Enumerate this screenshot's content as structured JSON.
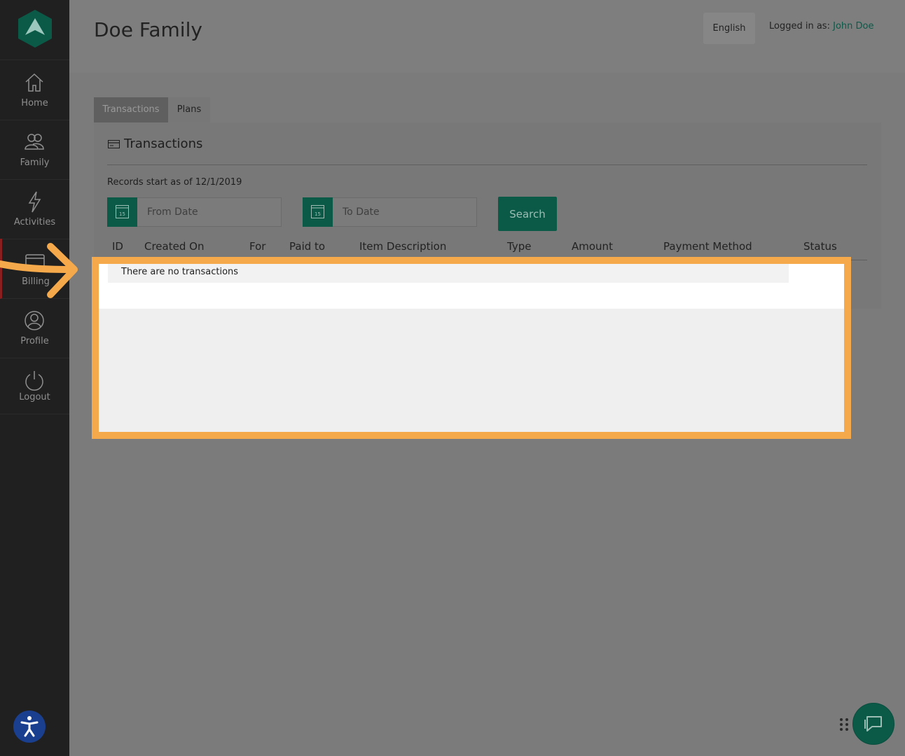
{
  "sidebar": {
    "items": [
      {
        "label": "Home",
        "icon": "home-icon"
      },
      {
        "label": "Family",
        "icon": "family-icon"
      },
      {
        "label": "Activities",
        "icon": "lightning-icon"
      },
      {
        "label": "Billing",
        "icon": "card-icon"
      },
      {
        "label": "Profile",
        "icon": "profile-icon"
      },
      {
        "label": "Logout",
        "icon": "power-icon"
      }
    ]
  },
  "header": {
    "title": "Doe Family",
    "language": "English",
    "logged_in_prefix": "Logged in as:",
    "user_name": "John Doe"
  },
  "tabs": [
    {
      "label": "Transactions",
      "active": true
    },
    {
      "label": "Plans",
      "active": false
    }
  ],
  "panel": {
    "title": "Transactions",
    "records_note": "Records start as of 12/1/2019",
    "from_placeholder": "From Date",
    "to_placeholder": "To Date",
    "calendar_day": "15",
    "search_label": "Search"
  },
  "table": {
    "columns": [
      "ID",
      "Created On",
      "For",
      "Paid to",
      "Item Description",
      "Type",
      "Amount",
      "Payment Method",
      "Status"
    ],
    "empty_message": "There are no transactions"
  },
  "colors": {
    "brand": "#0b5a48",
    "highlight": "#f5a94a",
    "sidebar": "#202020"
  }
}
